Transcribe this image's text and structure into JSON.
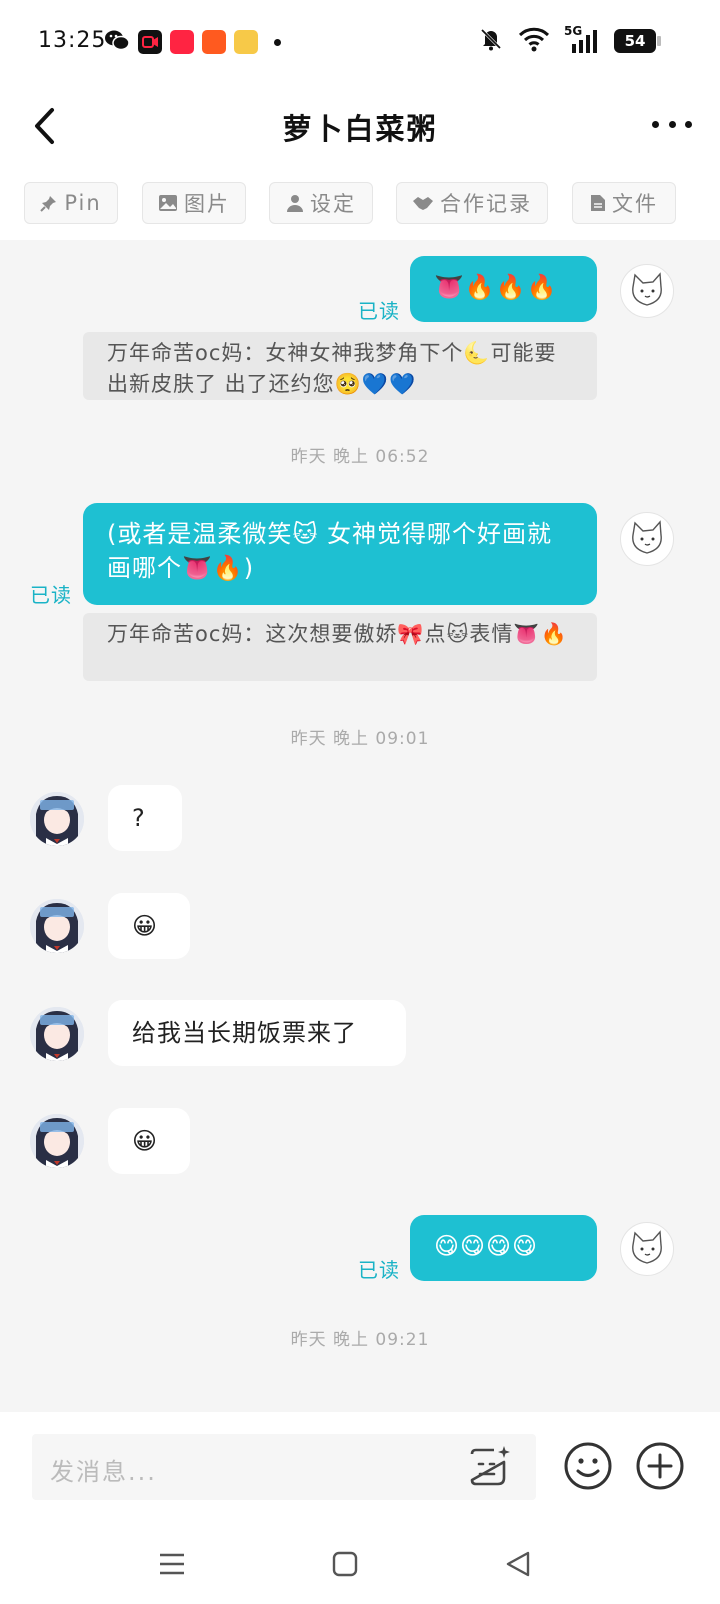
{
  "status_bar": {
    "time": "13:25",
    "network": "5G",
    "battery": "54"
  },
  "header": {
    "title": "萝卜白菜粥"
  },
  "tabs": [
    {
      "label": "Pin",
      "icon": "pin-icon"
    },
    {
      "label": "图片",
      "icon": "image-icon"
    },
    {
      "label": "设定",
      "icon": "person-icon"
    },
    {
      "label": "合作记录",
      "icon": "handshake-icon"
    },
    {
      "label": "文件",
      "icon": "file-icon"
    }
  ],
  "messages": {
    "m1": {
      "text": "👅🔥🔥🔥",
      "read": "已读"
    },
    "q1": {
      "text": "万年命苦oc妈：女神女神我梦角下个🌜可能要出新皮肤了 出了还约您🥺💙💙"
    },
    "t1": "昨天 晚上 06:52",
    "m2": {
      "text": "(或者是温柔微笑🐱 女神觉得哪个好画就画哪个👅🔥)",
      "read": "已读"
    },
    "q2": {
      "text": "万年命苦oc妈：这次想要傲娇🎀点🐱表情👅🔥"
    },
    "t2": "昨天 晚上 09:01",
    "r1": {
      "text": "?"
    },
    "r2": {
      "text": "😀"
    },
    "r3": {
      "text": "给我当长期饭票来了"
    },
    "r4": {
      "text": "😀"
    },
    "m3": {
      "text": "😋😋😋😋",
      "read": "已读"
    },
    "t3": "昨天 晚上 09:21"
  },
  "input": {
    "placeholder": "发消息..."
  },
  "colors": {
    "accent": "#1ec0d2",
    "read_label": "#1ab3c6",
    "chat_bg": "#f5f5f5"
  }
}
